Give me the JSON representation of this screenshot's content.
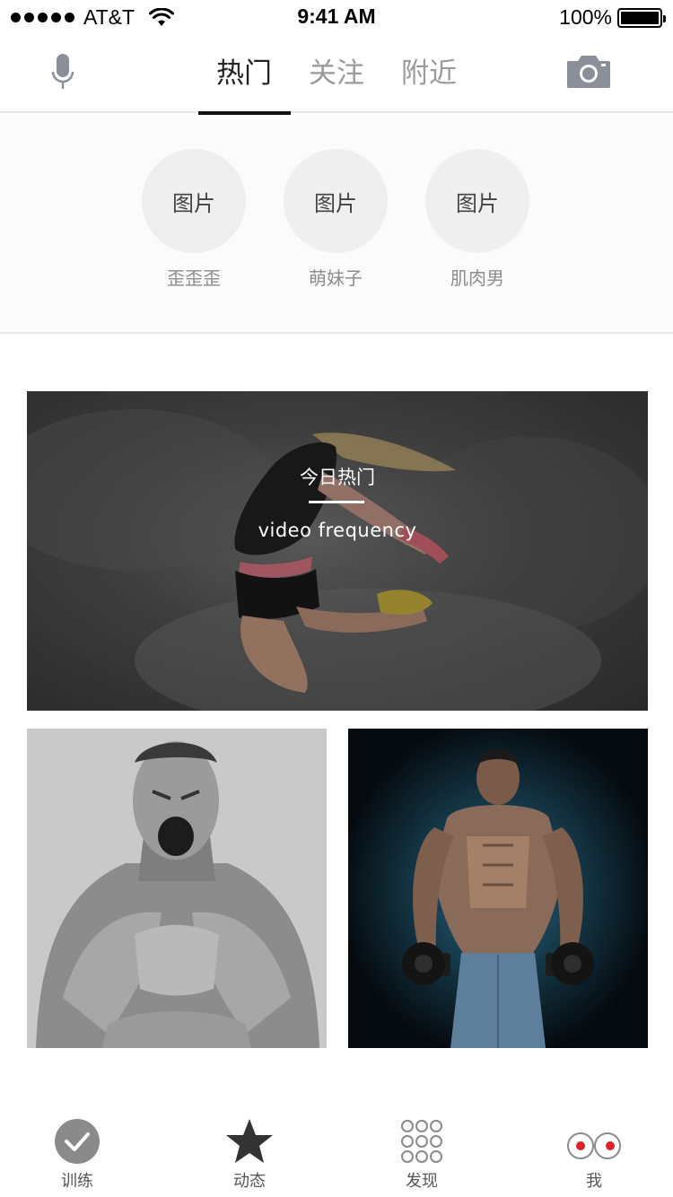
{
  "status_bar": {
    "carrier": "AT&T",
    "time": "9:41 AM",
    "battery": "100%"
  },
  "nav": {
    "tabs": [
      {
        "label": "热门",
        "active": true
      },
      {
        "label": "关注",
        "active": false
      },
      {
        "label": "附近",
        "active": false
      }
    ],
    "mic_icon": "microphone-icon",
    "camera_icon": "camera-icon"
  },
  "categories": [
    {
      "image_text": "图片",
      "label": "歪歪歪"
    },
    {
      "image_text": "图片",
      "label": "萌妹子"
    },
    {
      "image_text": "图片",
      "label": "肌肉男"
    }
  ],
  "banner": {
    "title": "今日热门",
    "subtitle": "video frequency"
  },
  "bottom_tabs": [
    {
      "label": "训练",
      "icon": "check-circle-icon"
    },
    {
      "label": "动态",
      "icon": "star-icon"
    },
    {
      "label": "发现",
      "icon": "dots-grid-icon"
    },
    {
      "label": "我",
      "icon": "eyes-icon"
    }
  ],
  "colors": {
    "accent_red": "#e0202a",
    "icon_gray": "#7a7a7a",
    "active_tab": "#222222",
    "inactive_tab": "#9a9a9a"
  }
}
